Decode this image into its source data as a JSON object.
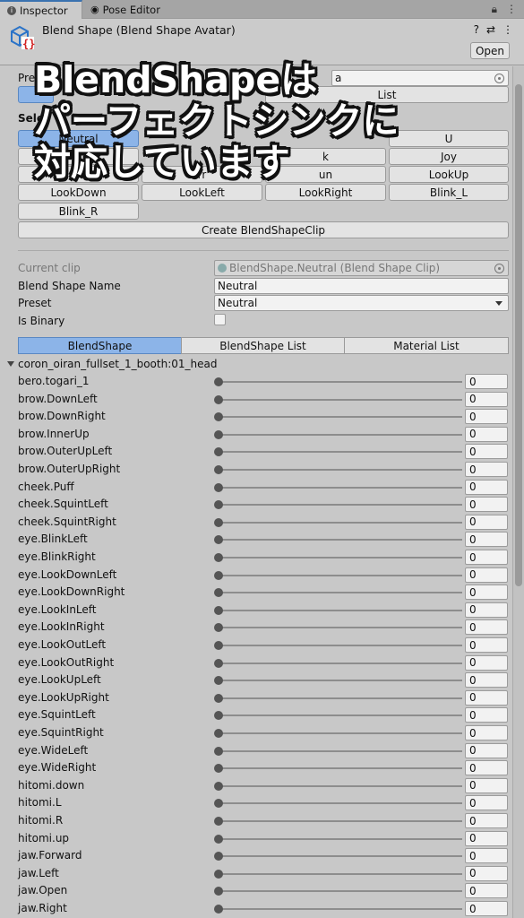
{
  "tabs": [
    {
      "label": "Inspector",
      "icon": "info-icon"
    },
    {
      "label": "Pose Editor",
      "icon": "eye-icon"
    }
  ],
  "header": {
    "title": "Blend Shape (Blend Shape Avatar)",
    "open_label": "Open"
  },
  "top": {
    "preset_label_partial": "Pre",
    "preset_field_partial": "a",
    "list_button": "List",
    "select_label_partial": "Sele"
  },
  "preset_buttons": [
    "Neutral",
    "U",
    "k",
    "Joy",
    "rr",
    "un",
    "LookUp",
    "LookDown",
    "LookLeft",
    "LookRight",
    "Blink_L",
    "Blink_R"
  ],
  "create_button": "Create BlendShapeClip",
  "clip": {
    "current_clip_label": "Current clip",
    "current_clip_value": "BlendShape.Neutral (Blend Shape Clip)",
    "name_label": "Blend Shape Name",
    "name_value": "Neutral",
    "preset_label": "Preset",
    "preset_value": "Neutral",
    "binary_label": "Is Binary"
  },
  "segments": [
    "BlendShape",
    "BlendShape List",
    "Material List"
  ],
  "mesh_name": "coron_oiran_fullset_1_booth:01_head",
  "blendshapes": [
    {
      "name": "bero.togari_1",
      "value": "0"
    },
    {
      "name": "brow.DownLeft",
      "value": "0"
    },
    {
      "name": "brow.DownRight",
      "value": "0"
    },
    {
      "name": "brow.InnerUp",
      "value": "0"
    },
    {
      "name": "brow.OuterUpLeft",
      "value": "0"
    },
    {
      "name": "brow.OuterUpRight",
      "value": "0"
    },
    {
      "name": "cheek.Puff",
      "value": "0"
    },
    {
      "name": "cheek.SquintLeft",
      "value": "0"
    },
    {
      "name": "cheek.SquintRight",
      "value": "0"
    },
    {
      "name": "eye.BlinkLeft",
      "value": "0"
    },
    {
      "name": "eye.BlinkRight",
      "value": "0"
    },
    {
      "name": "eye.LookDownLeft",
      "value": "0"
    },
    {
      "name": "eye.LookDownRight",
      "value": "0"
    },
    {
      "name": "eye.LookInLeft",
      "value": "0"
    },
    {
      "name": "eye.LookInRight",
      "value": "0"
    },
    {
      "name": "eye.LookOutLeft",
      "value": "0"
    },
    {
      "name": "eye.LookOutRight",
      "value": "0"
    },
    {
      "name": "eye.LookUpLeft",
      "value": "0"
    },
    {
      "name": "eye.LookUpRight",
      "value": "0"
    },
    {
      "name": "eye.SquintLeft",
      "value": "0"
    },
    {
      "name": "eye.SquintRight",
      "value": "0"
    },
    {
      "name": "eye.WideLeft",
      "value": "0"
    },
    {
      "name": "eye.WideRight",
      "value": "0"
    },
    {
      "name": "hitomi.down",
      "value": "0"
    },
    {
      "name": "hitomi.L",
      "value": "0"
    },
    {
      "name": "hitomi.R",
      "value": "0"
    },
    {
      "name": "hitomi.up",
      "value": "0"
    },
    {
      "name": "jaw.Forward",
      "value": "0"
    },
    {
      "name": "jaw.Left",
      "value": "0"
    },
    {
      "name": "jaw.Open",
      "value": "0"
    },
    {
      "name": "jaw.Right",
      "value": "0"
    }
  ],
  "overlay": [
    "BlendShapeは",
    "パーフェクトシンクに",
    "対応しています"
  ]
}
